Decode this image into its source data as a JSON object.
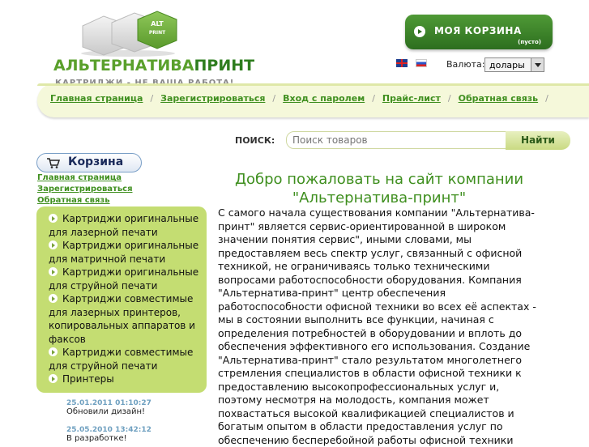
{
  "logo": {
    "badge_top": "ALT",
    "badge_bottom": "PRINT",
    "title_part1": "АЛЬТЕРНАТИВА",
    "title_part2": "ПРИНТ",
    "tagline": "КАРТРИДЖИ - НЕ ВАША РАБОТА!"
  },
  "cart_top": {
    "label": "МОЯ КОРЗИНА",
    "status": "(пусто)"
  },
  "currency": {
    "label": "Валюта:",
    "value": "долары"
  },
  "nav": {
    "items": [
      "Главная страница",
      "Зарегистрироваться",
      "Вход с паролем",
      "Прайс-лист",
      "Обратная связь"
    ],
    "separator": "/"
  },
  "search": {
    "label": "ПОИСК:",
    "placeholder": "Поиск товаров",
    "button": "Найти"
  },
  "left": {
    "cart_label": "Корзина",
    "links": [
      "Главная страница",
      "Зарегистрироваться",
      "Обратная связь"
    ],
    "categories": [
      "Картриджи оригинальные для лазерной печати",
      "Картриджи оригинальные для матричной печати",
      "Картриджи оригинальные для струйной печати",
      "Картриджи совместимые для лазерных принтеров, копировальных аппаратов и факсов",
      "Картриджи совместимые для струйной печати",
      "Принтеры"
    ],
    "news": [
      {
        "date": "25.01.2011 01:10:27",
        "text": "Обновили дизайн!"
      },
      {
        "date": "25.05.2010 13:42:12",
        "text": "В разработке!"
      }
    ]
  },
  "main": {
    "title_line1": "Добро пожаловать на сайт компании",
    "title_line2": "\"Альтернатива-принт\"",
    "body": "С самого начала существования компании \"Альтернатива-принт\" является сервис-ориентированной в широком значении понятия  сервис\", иными словами, мы предоставляем весь спектр услуг, связанный с офисной техникой, не ограничиваясь только техническими вопросами работоспособности оборудования. Компания \"Альтернатива-принт\"   центр обеспечения работоспособности офисной техники во всех её аспектах - мы в состоянии выполнить все функции, начиная с определения потребностей в оборудовании и вплоть до обеспечения эффективного его использования. Создание \"Альтернатива-принт\" стало результатом многолетнего стремления специалистов в области офисной техники к предоставлению высокопрофессиональных услуг и, поэтому несмотря на молодость, компания может похвастаться высокой квалификацией специалистов и богатым опытом в области предоставления услуг по обеспечению бесперебойной работы офисной техники"
  },
  "colors": {
    "accent_green": "#3f8f1f",
    "panel_green": "#c4dd72",
    "nav_bg": "#f5f8da"
  }
}
